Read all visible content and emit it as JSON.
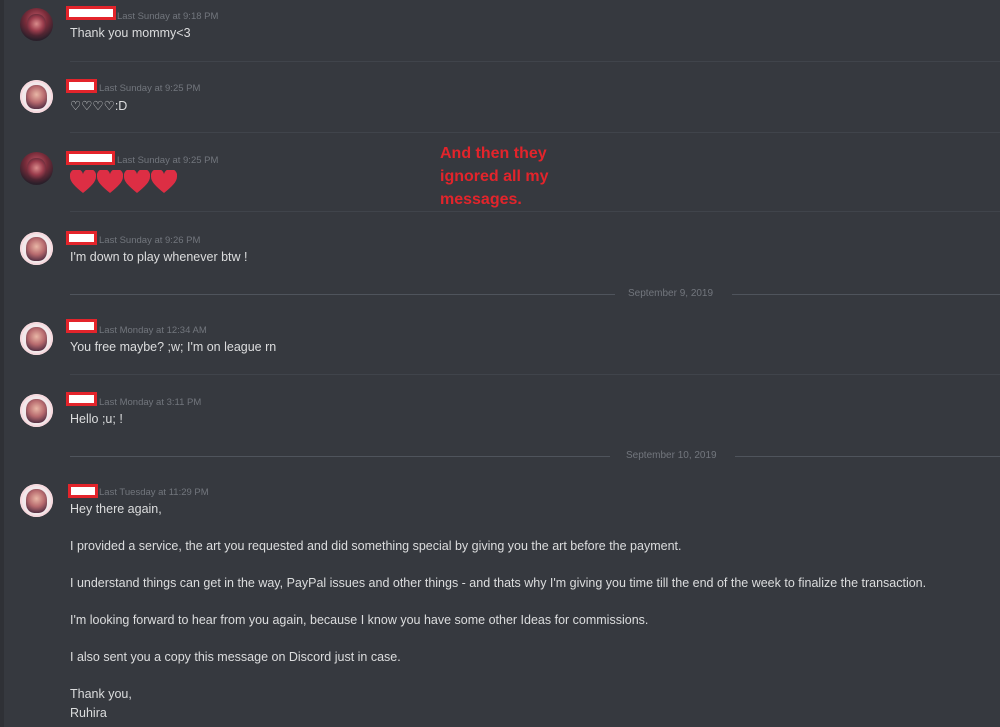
{
  "annotation": {
    "lines": [
      "And then they",
      "ignored all my",
      "messages."
    ],
    "color": "#e3242b"
  },
  "messages": [
    {
      "timestamp": "Last Sunday at 9:18 PM",
      "text": "Thank you mommy<3",
      "avatar": "dark-avatar"
    },
    {
      "timestamp": "Last Sunday at 9:25 PM",
      "text": "♡♡♡♡:D",
      "avatar": "light-avatar"
    },
    {
      "timestamp": "Last Sunday at 9:25 PM",
      "text": "",
      "emoji": "heart-icon",
      "emoji_count": 4,
      "avatar": "dark-avatar"
    },
    {
      "timestamp": "Last Sunday at 9:26 PM",
      "text": "I'm down to play whenever btw !",
      "avatar": "light-avatar"
    },
    {
      "timestamp": "Last Monday at 12:34 AM",
      "text": "You free maybe? ;w; I'm on league rn",
      "avatar": "light-avatar"
    },
    {
      "timestamp": "Last Monday at 3:11 PM",
      "text": "Hello ;u; !",
      "avatar": "light-avatar"
    },
    {
      "timestamp": "Last Tuesday at 11:29 PM",
      "avatar": "light-avatar",
      "lines": [
        "Hey there again,",
        "I provided a service, the art you requested and did something special by giving you the art before the payment.",
        "I understand things can get in the way, PayPal issues and other things -  and thats why I'm giving you time till the end of the week to finalize the transaction.",
        "I'm looking forward to hear from you again, because I know you have some other Ideas for commissions.",
        "I also sent you a copy this message on Discord just in case.",
        "Thank you,",
        "Ruhira"
      ]
    }
  ],
  "date_dividers": [
    "September 9, 2019",
    "September 10, 2019"
  ],
  "colors": {
    "background": "#36393f",
    "message_text": "#dcddde",
    "timestamp": "#72767d",
    "redaction_border": "#e3242b",
    "heart": "#dd2e44"
  }
}
